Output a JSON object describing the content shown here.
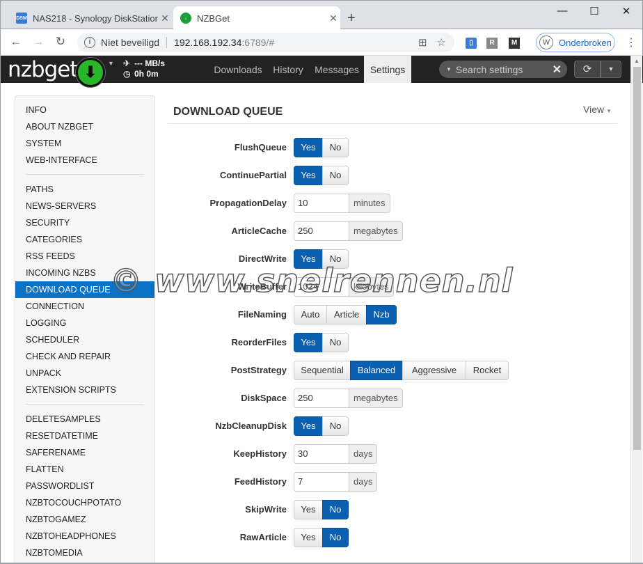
{
  "browser": {
    "tabs": [
      {
        "favicon": "DSM",
        "title": "NAS218 - Synology DiskStation"
      },
      {
        "favicon": "↓",
        "title": "NZBGet"
      }
    ],
    "address": {
      "security_label": "Niet beveiligd",
      "host": "192.168.192.34",
      "path": ":6789/#"
    },
    "extensions": [
      "R",
      "M"
    ],
    "profile": {
      "initial": "W",
      "name": "Onderbroken"
    }
  },
  "app": {
    "logo": "nzbget",
    "speed": "--- MB/s",
    "time": "0h 0m",
    "menu": [
      "Downloads",
      "History",
      "Messages",
      "Settings"
    ],
    "active_menu": "Settings",
    "search_placeholder": "Search settings",
    "accent_color": "#0b73c6"
  },
  "sidebar": {
    "groups": [
      [
        "INFO",
        "ABOUT NZBGET",
        "SYSTEM",
        "WEB-INTERFACE"
      ],
      [
        "PATHS",
        "NEWS-SERVERS",
        "SECURITY",
        "CATEGORIES",
        "RSS FEEDS",
        "INCOMING NZBS",
        "DOWNLOAD QUEUE",
        "CONNECTION",
        "LOGGING",
        "SCHEDULER",
        "CHECK AND REPAIR",
        "UNPACK",
        "EXTENSION SCRIPTS"
      ],
      [
        "DELETESAMPLES",
        "RESETDATETIME",
        "SAFERENAME",
        "FLATTEN",
        "PASSWORDLIST",
        "NZBTOCOUCHPOTATO",
        "NZBTOGAMEZ",
        "NZBTOHEADPHONES",
        "NZBTOMEDIA"
      ]
    ],
    "active": "DOWNLOAD QUEUE"
  },
  "panel": {
    "title": "DOWNLOAD QUEUE",
    "view_label": "View",
    "settings": [
      {
        "name": "FlushQueue",
        "type": "choice",
        "options": [
          "Yes",
          "No"
        ],
        "value": "Yes"
      },
      {
        "name": "ContinuePartial",
        "type": "choice",
        "options": [
          "Yes",
          "No"
        ],
        "value": "Yes"
      },
      {
        "name": "PropagationDelay",
        "type": "number",
        "value": "10",
        "unit": "minutes"
      },
      {
        "name": "ArticleCache",
        "type": "number",
        "value": "250",
        "unit": "megabytes"
      },
      {
        "name": "DirectWrite",
        "type": "choice",
        "options": [
          "Yes",
          "No"
        ],
        "value": "Yes"
      },
      {
        "name": "WriteBuffer",
        "type": "number",
        "value": "1024",
        "unit": "kilobytes"
      },
      {
        "name": "FileNaming",
        "type": "choice",
        "options": [
          "Auto",
          "Article",
          "Nzb"
        ],
        "value": "Nzb"
      },
      {
        "name": "ReorderFiles",
        "type": "choice",
        "options": [
          "Yes",
          "No"
        ],
        "value": "Yes"
      },
      {
        "name": "PostStrategy",
        "type": "choice",
        "options": [
          "Sequential",
          "Balanced",
          "Aggressive",
          "Rocket"
        ],
        "value": "Balanced"
      },
      {
        "name": "DiskSpace",
        "type": "number",
        "value": "250",
        "unit": "megabytes"
      },
      {
        "name": "NzbCleanupDisk",
        "type": "choice",
        "options": [
          "Yes",
          "No"
        ],
        "value": "Yes"
      },
      {
        "name": "KeepHistory",
        "type": "number",
        "value": "30",
        "unit": "days"
      },
      {
        "name": "FeedHistory",
        "type": "number",
        "value": "7",
        "unit": "days"
      },
      {
        "name": "SkipWrite",
        "type": "choice",
        "options": [
          "Yes",
          "No"
        ],
        "value": "No"
      },
      {
        "name": "RawArticle",
        "type": "choice",
        "options": [
          "Yes",
          "No"
        ],
        "value": "No"
      }
    ]
  },
  "watermark": "© www.snelrennen.nl"
}
